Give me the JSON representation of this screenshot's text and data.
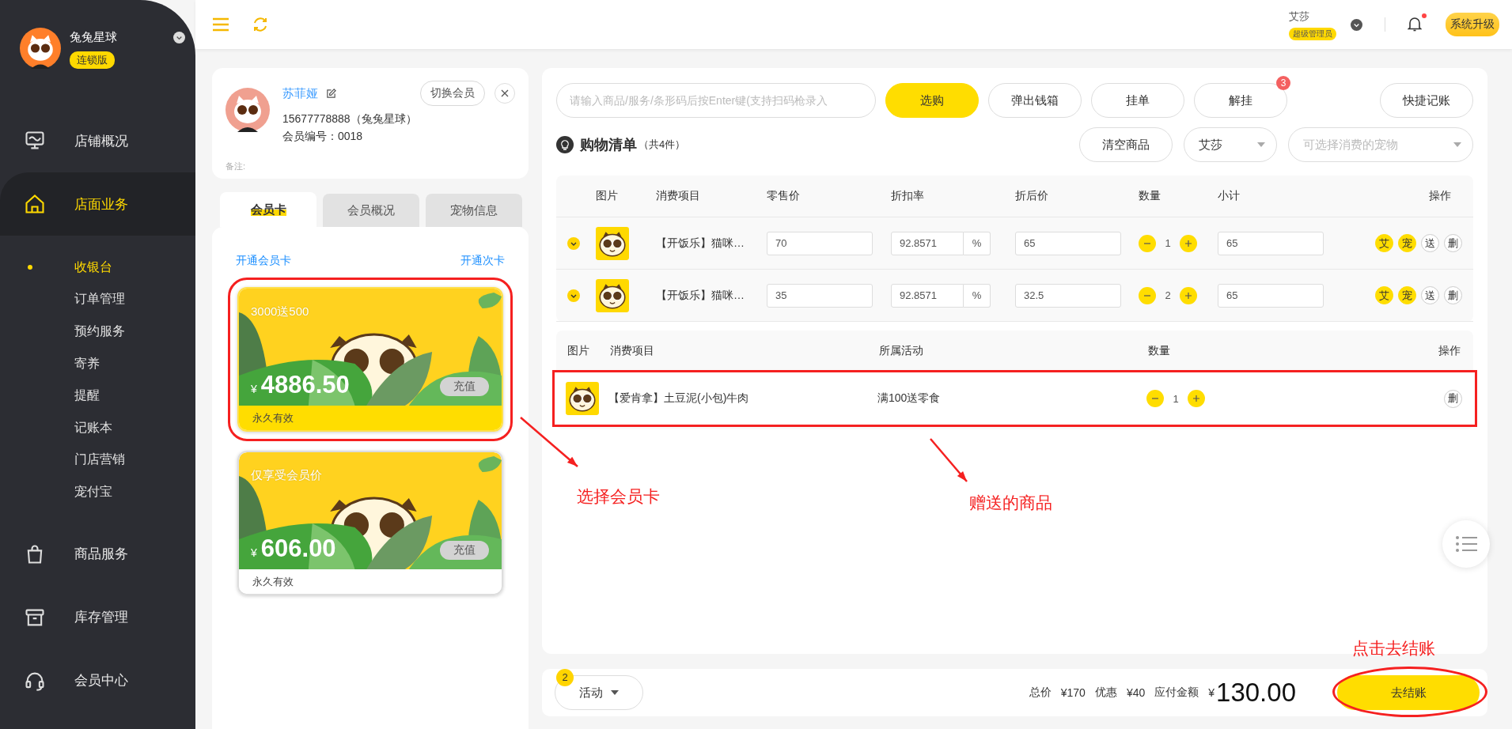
{
  "sidebar": {
    "store_name": "兔兔星球",
    "edition": "连锁版",
    "nav": [
      {
        "label": "店铺概况",
        "selected": false
      },
      {
        "label": "店面业务",
        "selected": true,
        "children": [
          {
            "label": "收银台",
            "selected": true
          },
          {
            "label": "订单管理",
            "selected": false
          },
          {
            "label": "预约服务",
            "selected": false
          },
          {
            "label": "寄养",
            "selected": false
          },
          {
            "label": "提醒",
            "selected": false
          },
          {
            "label": "记账本",
            "selected": false
          },
          {
            "label": "门店营销",
            "selected": false
          },
          {
            "label": "宠付宝",
            "selected": false
          }
        ]
      },
      {
        "label": "商品服务",
        "selected": false
      },
      {
        "label": "库存管理",
        "selected": false
      },
      {
        "label": "会员中心",
        "selected": false
      }
    ]
  },
  "topbar": {
    "user_name": "艾莎",
    "role": "超级管理员",
    "notification_unread": true,
    "upgrade_button": "系统升级"
  },
  "member": {
    "name": "苏菲娅",
    "phone": "15677778888（兔兔星球）",
    "member_no": "会员编号：0018",
    "note_label": "备注:",
    "switch_button": "切换会员",
    "tabs": [
      {
        "label": "会员卡",
        "selected": true
      },
      {
        "label": "会员概况",
        "selected": false
      },
      {
        "label": "宠物信息",
        "selected": false
      }
    ],
    "links": [
      "开通会员卡",
      "开通次卡"
    ],
    "cards": [
      {
        "title": "3000送500",
        "currency": "¥",
        "balance": "4886.50",
        "recharge_button": "充值",
        "validity": "永久有效",
        "selected": true,
        "highlighted": true
      },
      {
        "title": "仅享受会员价",
        "currency": "¥",
        "balance": "606.00",
        "recharge_button": "充值",
        "validity": "永久有效",
        "selected": false,
        "highlighted": false
      }
    ]
  },
  "cart": {
    "search": {
      "placeholder": "请输入商品/服务/条形码后按Enter键(支持扫码枪录入"
    },
    "buttons": [
      {
        "label": "选购",
        "kind": "primary"
      },
      {
        "label": "弹出钱箱",
        "kind": "plain"
      },
      {
        "label": "挂单",
        "kind": "plain"
      },
      {
        "label": "解挂",
        "kind": "plain",
        "badge": "3"
      }
    ],
    "quick_button": "快捷记账",
    "title": "购物清单",
    "count": "（共4件）",
    "clear_button": "清空商品",
    "staff_select": "艾莎",
    "pet_select": {
      "placeholder": "可选择消费的宠物"
    },
    "columns": [
      "图片",
      "消费项目",
      "零售价",
      "折扣率",
      "折后价",
      "数量",
      "小计",
      "操作"
    ],
    "rows": [
      {
        "name": "【开饭乐】猫咪…",
        "price": "70",
        "discount": "92.8571",
        "percent": "%",
        "after_price": "65",
        "quantity": "1",
        "subtotal": "65",
        "actions": [
          {
            "label": "艾",
            "on": true
          },
          {
            "label": "宠",
            "on": true
          },
          {
            "label": "送",
            "on": false
          },
          {
            "label": "删",
            "on": false
          }
        ]
      },
      {
        "name": "【开饭乐】猫咪…",
        "price": "35",
        "discount": "92.8571",
        "percent": "%",
        "after_price": "32.5",
        "quantity": "2",
        "subtotal": "65",
        "actions": [
          {
            "label": "艾",
            "on": true
          },
          {
            "label": "宠",
            "on": true
          },
          {
            "label": "送",
            "on": false
          },
          {
            "label": "删",
            "on": false
          }
        ]
      }
    ],
    "gift_columns": [
      "图片",
      "消费项目",
      "所属活动",
      "数量",
      "操作"
    ],
    "gifts": [
      {
        "name": "【爱肯拿】土豆泥(小包)牛肉",
        "activity": "满100送零食",
        "quantity": "1",
        "action": "删",
        "highlighted": true
      }
    ]
  },
  "checkout": {
    "activity_button": "活动",
    "activity_badge": "2",
    "total_label": "总价",
    "total": "¥170",
    "discount_label": "优惠",
    "discount": "¥40",
    "payable_label": "应付金额",
    "currency": "¥",
    "payable": "130.00",
    "checkout_button": "去结账",
    "circled": true
  },
  "annotations": [
    {
      "text": "选择会员卡"
    },
    {
      "text": "赠送的商品"
    },
    {
      "text": "点击去结账"
    }
  ]
}
